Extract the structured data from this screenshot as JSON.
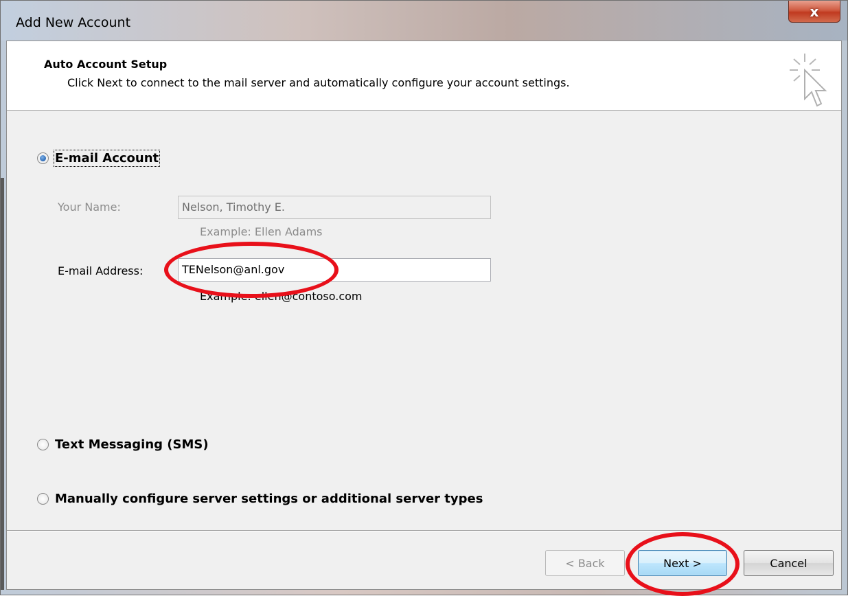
{
  "window": {
    "title": "Add New Account",
    "close_glyph": "x"
  },
  "header": {
    "title": "Auto Account Setup",
    "description": "Click Next to connect to the mail server and automatically configure your account settings."
  },
  "options": {
    "email_account": {
      "label": "E-mail Account",
      "selected": true
    },
    "text_messaging": {
      "label": "Text Messaging (SMS)",
      "selected": false
    },
    "manual_config": {
      "label": "Manually configure server settings or additional server types",
      "selected": false
    }
  },
  "form": {
    "your_name_label": "Your Name:",
    "your_name_value": "Nelson, Timothy E.",
    "your_name_example": "Example: Ellen Adams",
    "email_label": "E-mail Address:",
    "email_value": "TENelson@anl.gov",
    "email_example": "Example: ellen@contoso.com"
  },
  "buttons": {
    "back": "< Back",
    "next": "Next >",
    "cancel": "Cancel"
  },
  "annotations": {
    "highlight_color": "#e8101a"
  }
}
